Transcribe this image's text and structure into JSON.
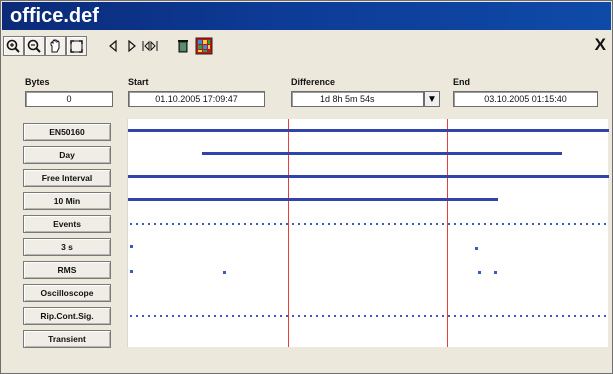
{
  "window": {
    "title": "office.def",
    "close_label": "X"
  },
  "toolbar": {
    "zoom_in_icon": "zoom-in-icon",
    "zoom_out_icon": "zoom-out-icon",
    "pan_icon": "hand-icon",
    "fit_icon": "fit-screen-icon",
    "prev_icon": "triangle-left-icon",
    "next_icon": "triangle-right-icon",
    "range_icon": "range-icon",
    "delete_icon": "trash-icon",
    "color_icon": "multicolor-grid-icon"
  },
  "meta": {
    "bytes_label": "Bytes",
    "bytes_value": "0",
    "start_label": "Start",
    "start_value": "01.10.2005  17:09:47",
    "difference_label": "Difference",
    "difference_value": "1d  8h  5m 54s",
    "end_label": "End",
    "end_value": "03.10.2005  01:15:40"
  },
  "channels": [
    "EN50160",
    "Day",
    "Free Interval",
    "10 Min",
    "Events",
    "3 s",
    "RMS",
    "Oscilloscope",
    "Rip.Cont.Sig.",
    "Transient"
  ],
  "colors": {
    "title_bg": "#0d3b96",
    "trace_blue": "#3045a7",
    "marker_red": "#e63e3a",
    "panel": "#ece8dc"
  }
}
